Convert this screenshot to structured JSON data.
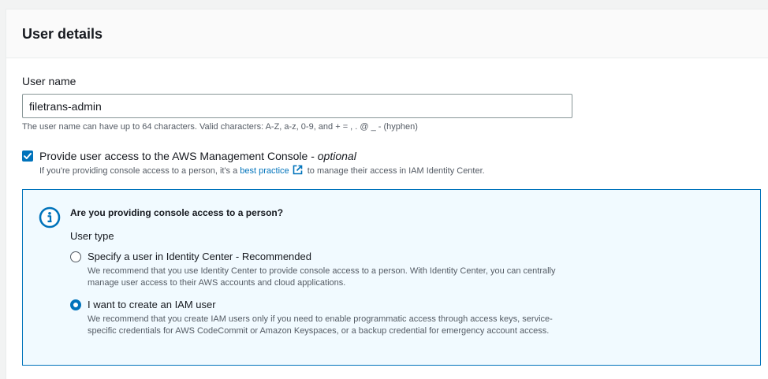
{
  "panel": {
    "title": "User details"
  },
  "user_name": {
    "label": "User name",
    "value": "filetrans-admin",
    "hint": "The user name can have up to 64 characters. Valid characters: A-Z, a-z, 0-9, and + = , . @ _ - (hyphen)"
  },
  "console_access": {
    "checked": true,
    "label": "Provide user access to the AWS Management Console - ",
    "optional": "optional",
    "desc_before": "If you're providing console access to a person, it's a ",
    "link_text": "best practice",
    "desc_after": " to manage their access in IAM Identity Center."
  },
  "info": {
    "icon": "info-icon",
    "title": "Are you providing console access to a person?",
    "user_type_label": "User type",
    "options": [
      {
        "label": "Specify a user in Identity Center - Recommended",
        "desc": "We recommend that you use Identity Center to provide console access to a person. With Identity Center, you can centrally manage user access to their AWS accounts and cloud applications.",
        "selected": false
      },
      {
        "label": "I want to create an IAM user",
        "desc": "We recommend that you create IAM users only if you need to enable programmatic access through access keys, service-specific credentials for AWS CodeCommit or Amazon Keyspaces, or a backup credential for emergency account access.",
        "selected": true
      }
    ]
  },
  "colors": {
    "accent": "#0073bb",
    "info_bg": "#f1faff",
    "text": "#16191f",
    "secondary_text": "#545b64"
  }
}
